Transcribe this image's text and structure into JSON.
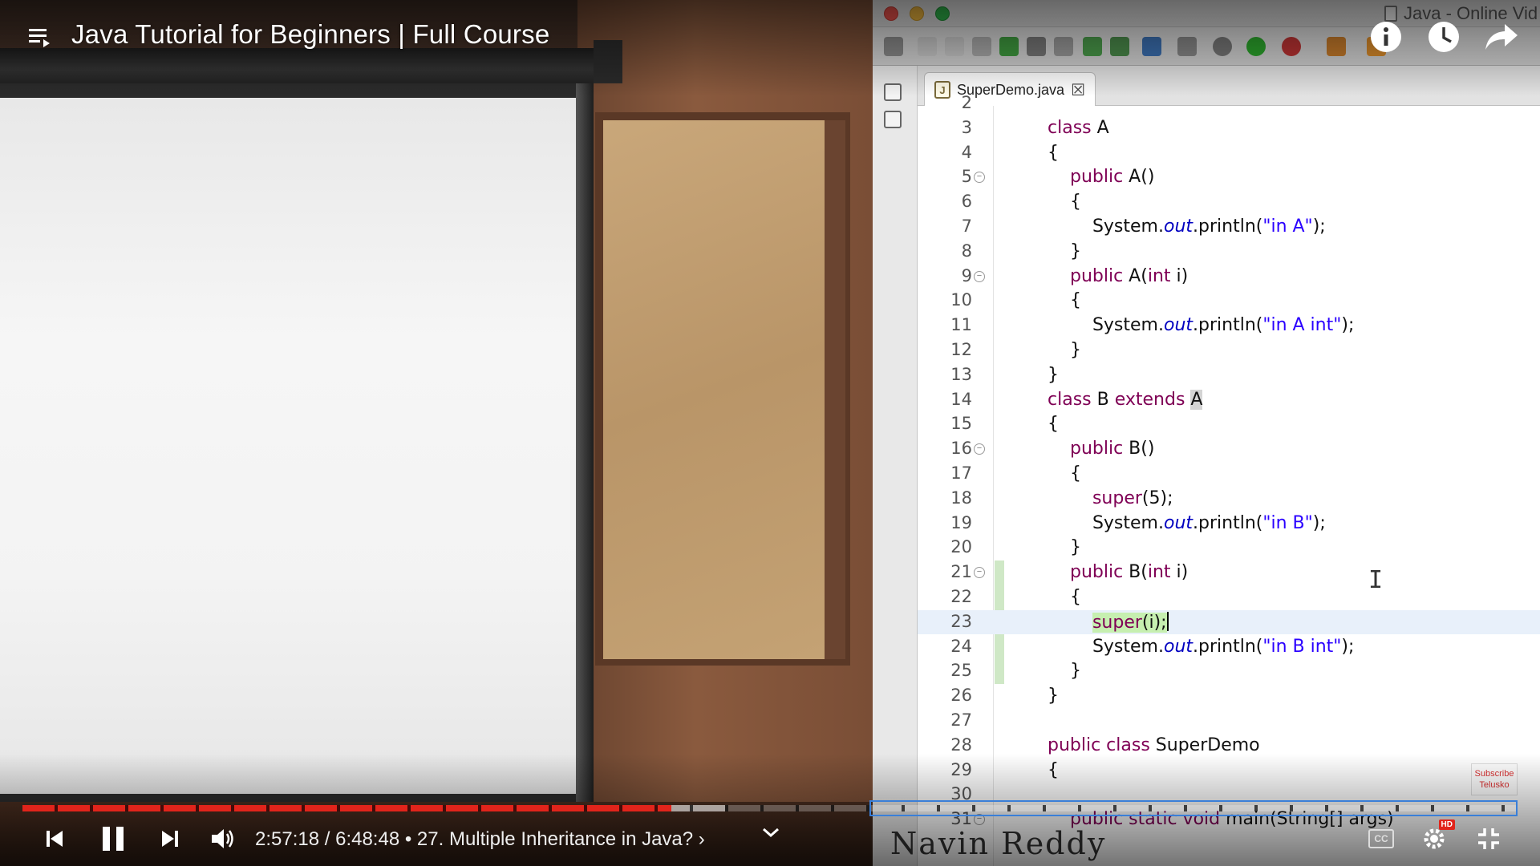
{
  "video": {
    "title": "Java Tutorial for Beginners | Full Course",
    "time_current": "2:57:18",
    "time_total": "6:48:48",
    "chapter": "27. Multiple Inheritance in Java?",
    "chapter_chevron": "›",
    "played_fraction": 0.434,
    "buffered_fraction": 0.47,
    "watermark": "Navin Reddy",
    "subscribe_line1": "Subscribe",
    "subscribe_line2": "Telusko",
    "hd_label": "HD",
    "cc_label": "CC"
  },
  "ide": {
    "window_title": "Java - Online Vid",
    "tab_label": "SuperDemo.java",
    "tab_close": "☒",
    "current_line": 23,
    "lines": [
      {
        "n": "2",
        "fold": false,
        "html": ""
      },
      {
        "n": "3",
        "fold": false,
        "html": "<span class=\"kw\">class</span> A"
      },
      {
        "n": "4",
        "fold": false,
        "html": "{"
      },
      {
        "n": "5",
        "fold": true,
        "html": "    <span class=\"kw\">public</span> A()"
      },
      {
        "n": "6",
        "fold": false,
        "html": "    {"
      },
      {
        "n": "7",
        "fold": false,
        "html": "        System.<span class=\"fld\">out</span>.println(<span class=\"str\">\"in A\"</span>);"
      },
      {
        "n": "8",
        "fold": false,
        "html": "    }"
      },
      {
        "n": "9",
        "fold": true,
        "html": "    <span class=\"kw\">public</span> A(<span class=\"kw\">int</span> i)"
      },
      {
        "n": "10",
        "fold": false,
        "html": "    {"
      },
      {
        "n": "11",
        "fold": false,
        "html": "        System.<span class=\"fld\">out</span>.println(<span class=\"str\">\"in A int\"</span>);"
      },
      {
        "n": "12",
        "fold": false,
        "html": "    }"
      },
      {
        "n": "13",
        "fold": false,
        "html": "}"
      },
      {
        "n": "14",
        "fold": false,
        "html": "<span class=\"kw\">class</span> B <span class=\"kw\">extends</span> <span class=\"hl-occ\">A</span>"
      },
      {
        "n": "15",
        "fold": false,
        "html": "{"
      },
      {
        "n": "16",
        "fold": true,
        "html": "    <span class=\"kw\">public</span> B()"
      },
      {
        "n": "17",
        "fold": false,
        "html": "    {"
      },
      {
        "n": "18",
        "fold": false,
        "html": "        <span class=\"kw\">super</span>(5);"
      },
      {
        "n": "19",
        "fold": false,
        "html": "        System.<span class=\"fld\">out</span>.println(<span class=\"str\">\"in B\"</span>);"
      },
      {
        "n": "20",
        "fold": false,
        "html": "    }"
      },
      {
        "n": "21",
        "fold": true,
        "html": "    <span class=\"kw\">public</span> B(<span class=\"kw\">int</span> i)"
      },
      {
        "n": "22",
        "fold": false,
        "html": "    {"
      },
      {
        "n": "23",
        "fold": false,
        "html": "        <span class=\"hl-green\"><span class=\"kw\">super</span>(i);</span><span class=\"caret\"></span>"
      },
      {
        "n": "24",
        "fold": false,
        "html": "        System.<span class=\"fld\">out</span>.println(<span class=\"str\">\"in B int\"</span>);"
      },
      {
        "n": "25",
        "fold": false,
        "html": "    }"
      },
      {
        "n": "26",
        "fold": false,
        "html": "}"
      },
      {
        "n": "27",
        "fold": false,
        "html": ""
      },
      {
        "n": "28",
        "fold": false,
        "html": "<span class=\"kw\">public class</span> SuperDemo"
      },
      {
        "n": "29",
        "fold": false,
        "html": "{"
      },
      {
        "n": "30",
        "fold": false,
        "html": ""
      },
      {
        "n": "31",
        "fold": true,
        "html": "    <span class=\"kw\">public static void</span> main(String[] args)"
      }
    ]
  },
  "icons": {
    "playlist": "playlist-icon",
    "info": "info-icon",
    "watch_later": "clock-icon",
    "share": "share-icon",
    "prev": "skip-previous-icon",
    "pause": "pause-icon",
    "next": "skip-next-icon",
    "volume": "volume-icon",
    "chevron": "chevron-down-icon",
    "cc": "cc-icon",
    "settings": "gear-icon",
    "exit_fullscreen": "exit-fullscreen-icon"
  },
  "colors": {
    "progress_played": "#e1241b",
    "keyword": "#7f0055",
    "string": "#2a00ff",
    "field": "#0000c0"
  }
}
